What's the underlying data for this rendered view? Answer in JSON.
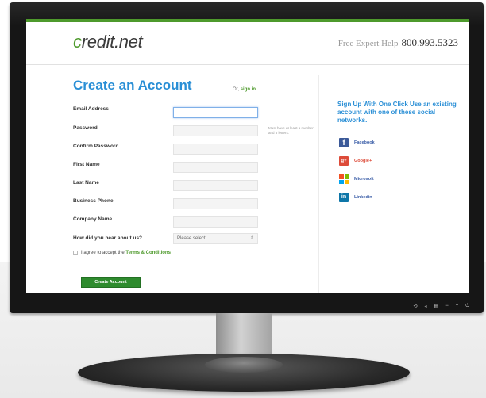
{
  "header": {
    "logo_c": "c",
    "logo_rest": "redit.net",
    "help_text": "Free Expert Help",
    "phone": "800.993.5323"
  },
  "form": {
    "title": "Create an Account",
    "signin_prefix": "Or,",
    "signin_link": "sign in.",
    "fields": [
      {
        "label": "Email Address"
      },
      {
        "label": "Password"
      },
      {
        "label": "Confirm Password"
      },
      {
        "label": "First Name"
      },
      {
        "label": "Last Name"
      },
      {
        "label": "Business Phone"
      },
      {
        "label": "Company Name"
      }
    ],
    "password_hint": "Must have at least 1 number and 8 letters.",
    "hear_label": "How did you hear about us?",
    "hear_selected": "Please select",
    "agree_text": "I agree to accept the",
    "terms_link": "Terms & Conditions",
    "submit_label": "Create Account"
  },
  "social": {
    "title": "Sign Up With One Click Use an existing account with one of these social networks.",
    "providers": [
      {
        "label": "Facebook",
        "icon": "facebook-icon"
      },
      {
        "label": "Google+",
        "icon": "google-plus-icon"
      },
      {
        "label": "Microsoft",
        "icon": "microsoft-icon"
      },
      {
        "label": "Linkedin",
        "icon": "linkedin-icon"
      }
    ]
  },
  "monitor_controls": [
    "⟲",
    "◃",
    "▤",
    "−",
    "+",
    "⏻"
  ],
  "colors": {
    "accent_green": "#4e9a2c",
    "title_blue": "#2a8fd6",
    "button_green": "#2e8b2e"
  }
}
